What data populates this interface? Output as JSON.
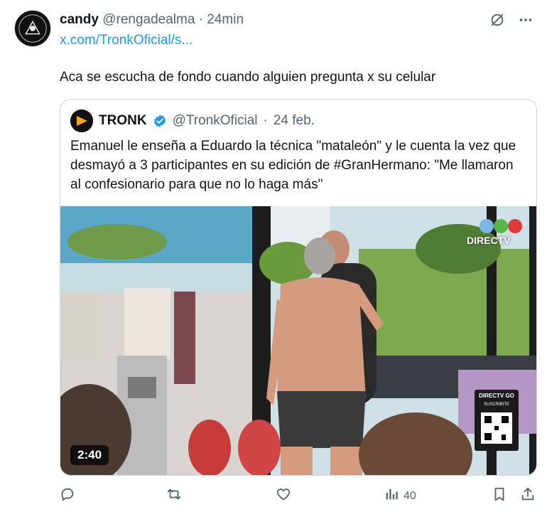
{
  "tweet": {
    "author_name": "candy",
    "author_handle": "@rengadealma",
    "separator": "·",
    "time": "24min",
    "link": "x.com/TronkOficial/s...",
    "text": "Aca se escucha de fondo cuando alguien pregunta x su celular"
  },
  "quoted": {
    "name": "TRONK",
    "handle": "@TronkOficial",
    "separator": "·",
    "date": "24 feb.",
    "text": "Emanuel le enseña a Eduardo la técnica \"mataleón\" y le cuenta la vez que desmayó a 3 participantes en su edición de #GranHermano: \"Me llamaron al confesionario para que no lo haga más\"",
    "video_duration": "2:40",
    "overlay": {
      "channel": "DIRECTV",
      "promo_top": "DIRECTV GO",
      "promo_sub": "SUSCRIBITE"
    }
  },
  "actions": {
    "views": "40"
  },
  "icons": {
    "avatar": "user-avatar-icon",
    "mute": "mute-icon",
    "more": "more-icon",
    "verified": "verified-badge-icon",
    "reply": "reply-icon",
    "retweet": "retweet-icon",
    "like": "like-icon",
    "views": "views-icon",
    "bookmark": "bookmark-icon",
    "share": "share-icon"
  },
  "colors": {
    "link": "#1d9bf0",
    "muted": "#536471",
    "verified": "#1d9bf0",
    "border": "#cfd9de"
  }
}
